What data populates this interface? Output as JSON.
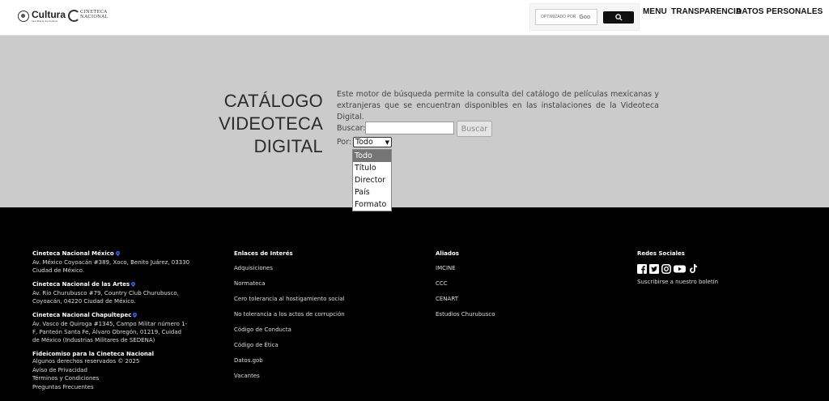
{
  "header": {
    "cultura_logo": "Cultura",
    "cultura_sub": "Secretaría de Cultura",
    "cineteca_logo_line1": "CINETECA",
    "cineteca_logo_line2": "NACIONAL",
    "search_placeholder": "OPTIMIZADO POR",
    "search_brand": "Goo",
    "nav": [
      "MENU",
      "TRANSPARENCIA",
      "DATOS PERSONALES"
    ]
  },
  "hero": {
    "title_lines": [
      "CATÁLOGO",
      "VIDEOTECA",
      "DIGITAL"
    ],
    "description": "Este motor de búsqueda permite la consulta del catálogo de películas mexicanas y extranjeras que se encuentran disponibles en las instalaciones de la Videoteca Digital.",
    "buscar_label": "Buscar:",
    "buscar_value": "",
    "buscar_button": "Buscar",
    "por_label": "Por:",
    "por_selected": "Todo",
    "por_options": [
      "Todo",
      "Título",
      "Director",
      "País",
      "Formato"
    ]
  },
  "footer": {
    "locations": [
      {
        "title": "Cineteca Nacional México",
        "address": "Av. México Coyoacán #389, Xoco, Benito Juárez, 03330 Ciudad de México."
      },
      {
        "title": "Cineteca Nacional de las Artes",
        "address": "Av. Río Churubusco #79, Country Club Churubusco, Coyoacán, 04220 Ciudad de México."
      },
      {
        "title": "Cineteca Nacional Chapultepec",
        "address": "Av. Vasco de Quiroga #1345, Campo Militar número 1-F, Panteón Santa Fe, Álvaro Obregón, 01219, Cuidad de México (Industrias Militares de SEDENA)"
      }
    ],
    "fideicomiso": "Fideicomiso para la Cineteca Nacional",
    "legal": [
      "Algunos derechos reservados © 2025",
      "Aviso de Privacidad",
      "Términos y Condiciones",
      "Preguntas Frecuentes"
    ],
    "enlaces_title": "Enlaces de Interés",
    "enlaces": [
      "Adquisiciones",
      "Normateca",
      "Cero tolerancia al hostigamiento social",
      "No tolerancia a los actos de corrupción",
      "Código de Conducta",
      "Código de Ética",
      "Datos.gob",
      "Vacantes"
    ],
    "aliados_title": "Aliados",
    "aliados": [
      "IMCINE",
      "CCC",
      "CENART",
      "Estudios Churubusco"
    ],
    "redes_title": "Redes Sociales",
    "social_icons": [
      "facebook-icon",
      "twitter-icon",
      "instagram-icon",
      "youtube-icon",
      "tiktok-icon"
    ],
    "newsletter": "Suscribirse a nuestro boletín",
    "pin_color": "#2a6df4"
  }
}
